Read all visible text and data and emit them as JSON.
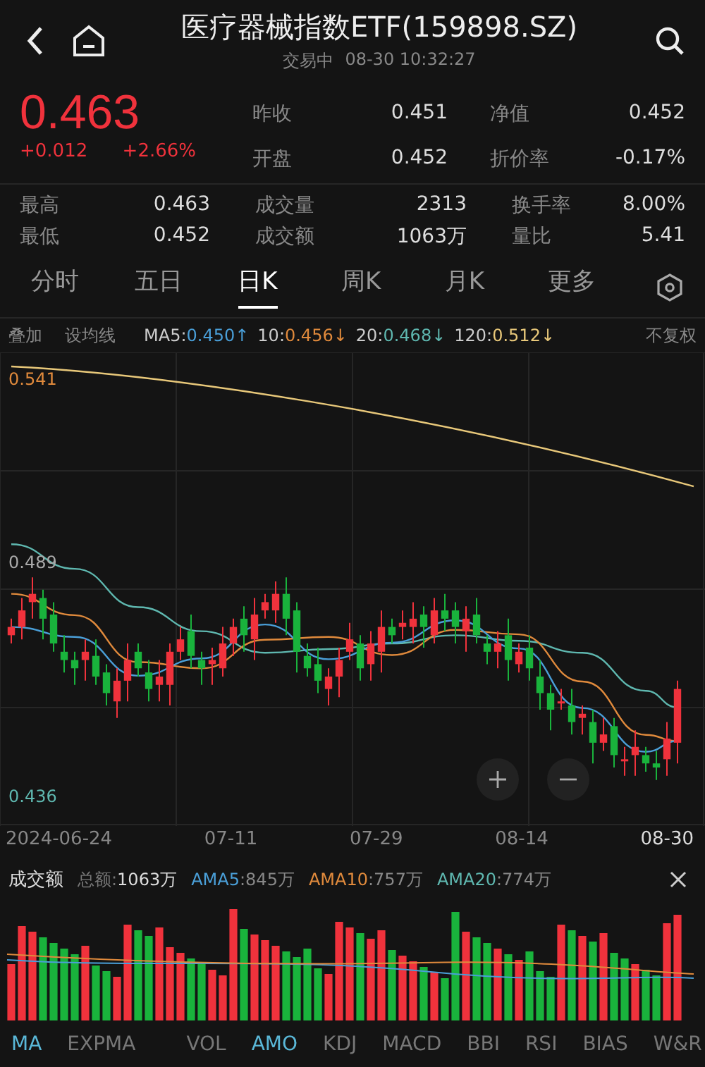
{
  "header": {
    "title": "医疗器械指数ETF(159898.SZ)",
    "status": "交易中",
    "time": "08-30 10:32:27"
  },
  "quote": {
    "price": "0.463",
    "change": "+0.012",
    "change_pct": "+2.66%"
  },
  "quote_stats": [
    {
      "label": "昨收",
      "value": "0.451"
    },
    {
      "label": "净值",
      "value": "0.452"
    },
    {
      "label": "开盘",
      "value": "0.452"
    },
    {
      "label": "折价率",
      "value": "-0.17%"
    }
  ],
  "stats": [
    {
      "label": "最高",
      "value": "0.463"
    },
    {
      "label": "成交量",
      "value": "2313"
    },
    {
      "label": "换手率",
      "value": "8.00%"
    },
    {
      "label": "最低",
      "value": "0.452"
    },
    {
      "label": "成交额",
      "value": "1063万"
    },
    {
      "label": "量比",
      "value": "5.41"
    }
  ],
  "period_tabs": [
    {
      "label": "分时",
      "selected": false
    },
    {
      "label": "五日",
      "selected": false
    },
    {
      "label": "日K",
      "selected": true
    },
    {
      "label": "周K",
      "selected": false
    },
    {
      "label": "月K",
      "selected": false
    },
    {
      "label": "更多",
      "selected": false
    }
  ],
  "ma_bar": {
    "overlay": "叠加",
    "set_ma": "设均线",
    "items": [
      {
        "name": "MA5:",
        "value": "0.450",
        "arrow": "↑",
        "color": "#4a9fd8"
      },
      {
        "name": "10:",
        "value": "0.456",
        "arrow": "↓",
        "color": "#e08a3c"
      },
      {
        "name": "20:",
        "value": "0.468",
        "arrow": "↓",
        "color": "#5fb8b0"
      },
      {
        "name": "120:",
        "value": "0.512",
        "arrow": "↓",
        "color": "#e8c87a"
      }
    ],
    "adjust": "不复权"
  },
  "price_chart": {
    "high_label": "0.541",
    "mid_label": "0.489",
    "low_label": "0.436",
    "dates": [
      "2024-06-24",
      "07-11",
      "07-29",
      "08-14",
      "08-30"
    ]
  },
  "volume": {
    "title": "成交额",
    "total_label": "总额:",
    "total": "1063万",
    "items": [
      {
        "name": "AMA5",
        "value": ":845万",
        "color": "#4a9fd8"
      },
      {
        "name": "AMA10",
        "value": ":757万",
        "color": "#e08a3c"
      },
      {
        "name": "AMA20",
        "value": ":774万",
        "color": "#5fb8b0"
      }
    ]
  },
  "indicator_tabs": [
    {
      "label": "MA",
      "selected": true
    },
    {
      "label": "EXPMA",
      "selected": false
    },
    {
      "label": "VOL",
      "selected": false
    },
    {
      "label": "AMO",
      "selected": true
    },
    {
      "label": "KDJ",
      "selected": false
    },
    {
      "label": "MACD",
      "selected": false
    },
    {
      "label": "BBI",
      "selected": false
    },
    {
      "label": "RSI",
      "selected": false
    },
    {
      "label": "BIAS",
      "selected": false
    },
    {
      "label": "W&R",
      "selected": false
    }
  ]
}
